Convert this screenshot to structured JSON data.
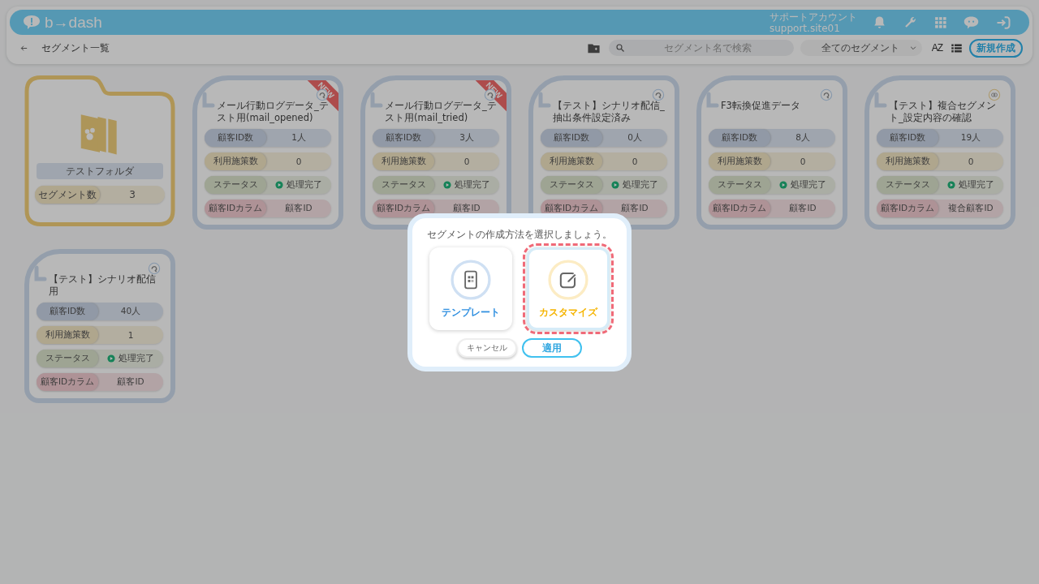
{
  "header": {
    "logo": "b→dash",
    "account_name": "サポートアカウント",
    "account_id": "support.site01"
  },
  "toolbar": {
    "title": "セグメント一覧",
    "search": {
      "placeholder": "セグメント名で検索"
    },
    "filter": "全てのセグメント",
    "sort_label": "AZ",
    "new_button": "新規作成"
  },
  "folders": [
    {
      "name": "テストフォルダ",
      "count_label": "セグメント数",
      "count": "3"
    }
  ],
  "segments": [
    {
      "title": "メール行動ログデータ_テスト用(mail_opened)",
      "badge": "NEW",
      "kind": "single",
      "rows": [
        {
          "kind": "ids",
          "label": "顧客ID数",
          "value": "1人"
        },
        {
          "kind": "measures",
          "label": "利用施策数",
          "value": "0"
        },
        {
          "kind": "status",
          "label": "ステータス",
          "value": "処理完了"
        },
        {
          "kind": "column",
          "label": "顧客IDカラム",
          "value": "顧客ID"
        }
      ]
    },
    {
      "title": "メール行動ログデータ_テスト用(mail_tried)",
      "badge": "NEW",
      "kind": "single",
      "rows": [
        {
          "kind": "ids",
          "label": "顧客ID数",
          "value": "3人"
        },
        {
          "kind": "measures",
          "label": "利用施策数",
          "value": "0"
        },
        {
          "kind": "status",
          "label": "ステータス",
          "value": "処理完了"
        },
        {
          "kind": "column",
          "label": "顧客IDカラム",
          "value": "顧客ID"
        }
      ]
    },
    {
      "title": "【テスト】シナリオ配信_抽出条件設定済み",
      "kind": "single",
      "rows": [
        {
          "kind": "ids",
          "label": "顧客ID数",
          "value": "0人"
        },
        {
          "kind": "measures",
          "label": "利用施策数",
          "value": "0"
        },
        {
          "kind": "status",
          "label": "ステータス",
          "value": "処理完了"
        },
        {
          "kind": "column",
          "label": "顧客IDカラム",
          "value": "顧客ID"
        }
      ]
    },
    {
      "title": "F3転換促進データ",
      "kind": "single",
      "rows": [
        {
          "kind": "ids",
          "label": "顧客ID数",
          "value": "8人"
        },
        {
          "kind": "measures",
          "label": "利用施策数",
          "value": "0"
        },
        {
          "kind": "status",
          "label": "ステータス",
          "value": "処理完了"
        },
        {
          "kind": "column",
          "label": "顧客IDカラム",
          "value": "顧客ID"
        }
      ]
    },
    {
      "title": "【テスト】複合セグメント_設定内容の確認",
      "kind": "compound",
      "rows": [
        {
          "kind": "ids",
          "label": "顧客ID数",
          "value": "19人"
        },
        {
          "kind": "measures",
          "label": "利用施策数",
          "value": "0"
        },
        {
          "kind": "status",
          "label": "ステータス",
          "value": "処理完了"
        },
        {
          "kind": "column",
          "label": "顧客IDカラム",
          "value": "複合顧客ID"
        }
      ]
    },
    {
      "title": "【テスト】シナリオ配信用",
      "kind": "single",
      "rows": [
        {
          "kind": "ids",
          "label": "顧客ID数",
          "value": "40人"
        },
        {
          "kind": "measures",
          "label": "利用施策数",
          "value": "1"
        },
        {
          "kind": "status",
          "label": "ステータス",
          "value": "処理完了"
        },
        {
          "kind": "column",
          "label": "顧客IDカラム",
          "value": "顧客ID"
        }
      ]
    }
  ],
  "dialog": {
    "prompt": "セグメントの作成方法を選択しましょう。",
    "options": [
      {
        "kind": "template",
        "label": "テンプレート",
        "selected": false
      },
      {
        "kind": "custom",
        "label": "カスタマイズ",
        "selected": true
      }
    ],
    "cancel": "キャンセル",
    "apply": "適用"
  }
}
